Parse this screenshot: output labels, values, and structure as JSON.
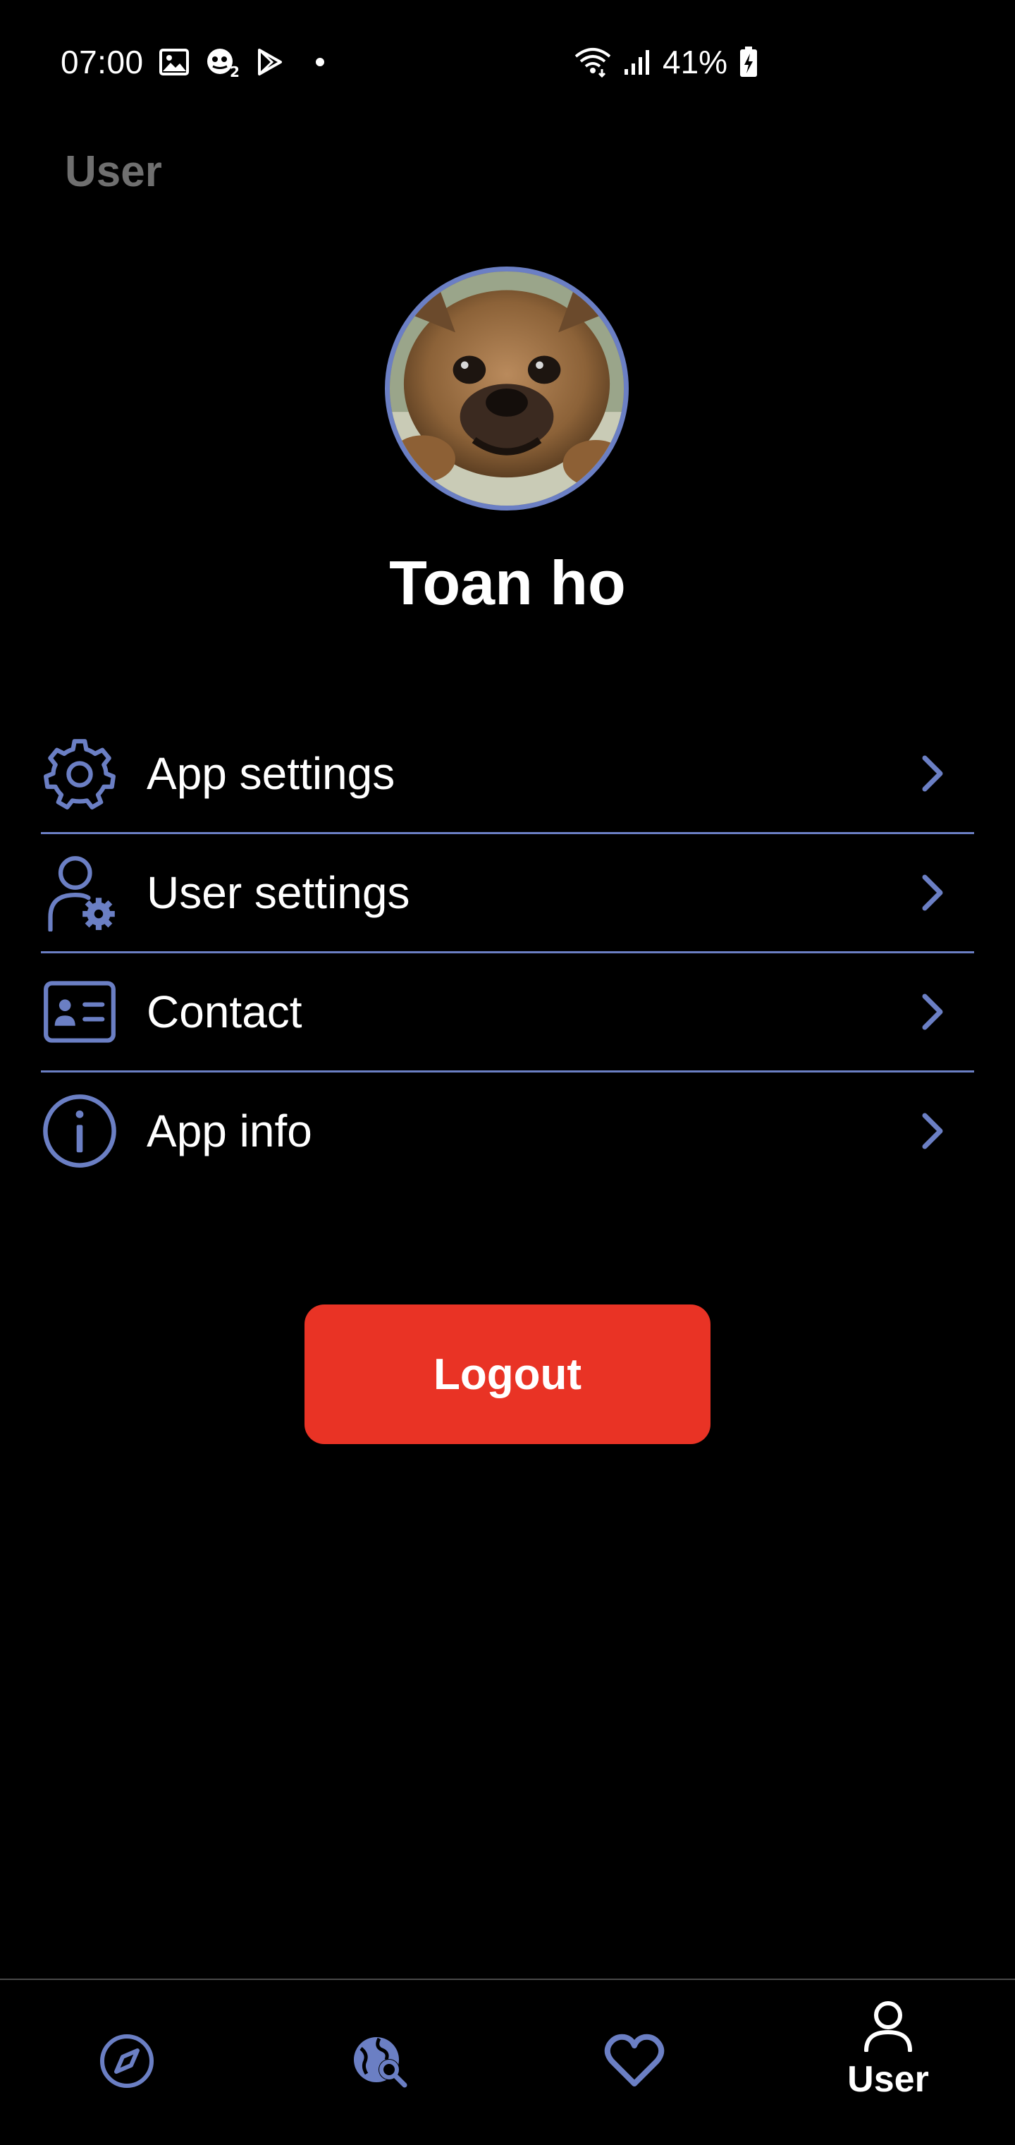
{
  "status_bar": {
    "time": "07:00",
    "battery_percent": "41%",
    "icons_left": [
      "gallery-icon",
      "game-notification-icon",
      "play-store-icon",
      "notification-dot"
    ],
    "icons_right": [
      "wifi-icon",
      "signal-icon",
      "battery-charging-icon"
    ]
  },
  "header": {
    "title": "User"
  },
  "profile": {
    "name": "Toan ho",
    "avatar_icon": "dog-photo-avatar"
  },
  "menu": {
    "items": [
      {
        "label": "App settings",
        "icon": "gear-icon"
      },
      {
        "label": "User settings",
        "icon": "user-settings-icon"
      },
      {
        "label": "Contact",
        "icon": "contact-card-icon"
      },
      {
        "label": "App info",
        "icon": "info-icon"
      }
    ]
  },
  "logout": {
    "label": "Logout"
  },
  "bottom_nav": {
    "items": [
      {
        "icon": "compass-icon",
        "label": ""
      },
      {
        "icon": "globe-search-icon",
        "label": ""
      },
      {
        "icon": "heart-icon",
        "label": ""
      },
      {
        "icon": "user-icon",
        "label": "User",
        "active": true
      }
    ]
  },
  "colors": {
    "background": "#000000",
    "accent": "#6b7fc4",
    "logout": "#e93325",
    "title_muted": "#6f6f6f",
    "text": "#ffffff"
  }
}
